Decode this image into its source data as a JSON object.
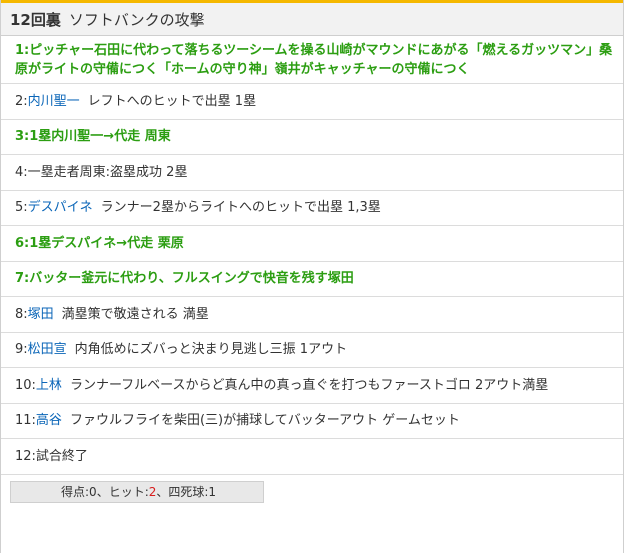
{
  "header": {
    "inning": "12回裏",
    "title": "ソフトバンクの攻撃"
  },
  "plays": [
    {
      "num": "1:",
      "player": "",
      "text": "ピッチャー石田に代わって落ちるツーシームを操る山崎がマウンドにあがる「燃えるガッツマン」桑原がライトの守備につく「ホームの守り神」嶺井がキャッチャーの守備につく",
      "green": true,
      "tall": true
    },
    {
      "num": "2:",
      "player": "内川聖一",
      "text": "レフトへのヒットで出塁 1塁",
      "green": false,
      "tall": false
    },
    {
      "num": "3:",
      "player": "",
      "text": "1塁内川聖一→代走 周東",
      "green": true,
      "tall": false
    },
    {
      "num": "4:",
      "player": "",
      "text": "一塁走者周東:盗塁成功 2塁",
      "green": false,
      "tall": false
    },
    {
      "num": "5:",
      "player": "デスパイネ",
      "text": "ランナー2塁からライトへのヒットで出塁 1,3塁",
      "green": false,
      "tall": false
    },
    {
      "num": "6:",
      "player": "",
      "text": "1塁デスパイネ→代走 栗原",
      "green": true,
      "tall": false
    },
    {
      "num": "7:",
      "player": "",
      "text": "バッター釜元に代わり、フルスイングで快音を残す塚田",
      "green": true,
      "tall": false
    },
    {
      "num": "8:",
      "player": "塚田",
      "text": "満塁策で敬遠される 満塁",
      "green": false,
      "tall": false
    },
    {
      "num": "9:",
      "player": "松田宣",
      "text": "内角低めにズバっと決まり見逃し三振 1アウト",
      "green": false,
      "tall": false
    },
    {
      "num": "10:",
      "player": "上林",
      "text": "ランナーフルベースからど真ん中の真っ直ぐを打つもファーストゴロ 2アウト満塁",
      "green": false,
      "tall": false
    },
    {
      "num": "11:",
      "player": "高谷",
      "text": "ファウルフライを柴田(三)が捕球してバッターアウト ゲームセット",
      "green": false,
      "tall": false
    },
    {
      "num": "12:",
      "player": "",
      "text": "試合終了",
      "green": false,
      "tall": false
    }
  ],
  "summary": {
    "runs_label": "得点:",
    "runs": "0",
    "hits_label": "、ヒット:",
    "hits": "2",
    "walks_label": "、四死球:",
    "walks": "1"
  },
  "colors": {
    "accent_bar": "#f5b800",
    "green_text": "#2c9e12",
    "player_link": "#0b66b8",
    "hits": "#d81c1c"
  }
}
